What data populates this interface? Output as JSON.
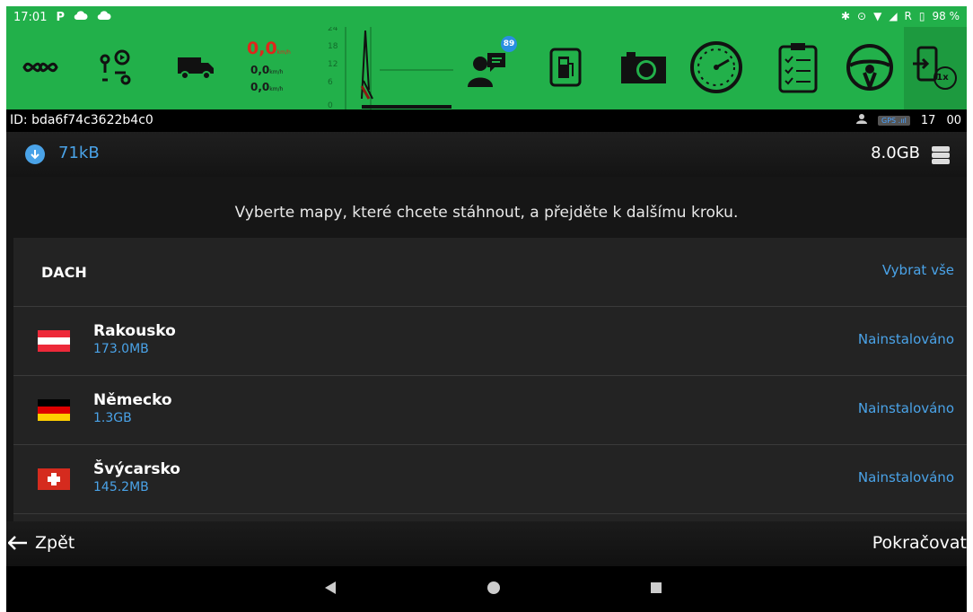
{
  "status_bar": {
    "time": "17:01",
    "battery": "98 %",
    "network_letter": "R"
  },
  "toolbar": {
    "speed_main": "0,0",
    "speed_sub1": "0,0",
    "speed_sub2": "0,0",
    "speed_unit": "km/h",
    "gauge_ticks": [
      "24",
      "18",
      "12",
      "6",
      "0"
    ],
    "message_badge": "89",
    "last_button_label": "1x"
  },
  "id_bar": {
    "device_id": "ID: bda6f74c3622b4c0",
    "gps_label": "GPS",
    "counter1": "17",
    "counter2": "00"
  },
  "info_row": {
    "download_size": "71kB",
    "storage_size": "8.0GB"
  },
  "instruction": "Vyberte mapy, které chcete stáhnout, a přejděte k dalšímu kroku.",
  "map_card": {
    "region_title": "DACH",
    "select_all": "Vybrat vše",
    "countries": [
      {
        "name": "Rakousko",
        "size": "173.0MB",
        "status": "Nainstalováno",
        "flag": "austria-flag"
      },
      {
        "name": "Německo",
        "size": "1.3GB",
        "status": "Nainstalováno",
        "flag": "germany-flag"
      },
      {
        "name": "Švýcarsko",
        "size": "145.2MB",
        "status": "Nainstalováno",
        "flag": "switzerland-flag"
      }
    ]
  },
  "bottom_nav": {
    "back_label": "Zpět",
    "continue_label": "Pokračovat"
  },
  "colors": {
    "accent_green": "#22b04a",
    "link_blue": "#4aa3e8",
    "speed_red": "#e0261b"
  }
}
